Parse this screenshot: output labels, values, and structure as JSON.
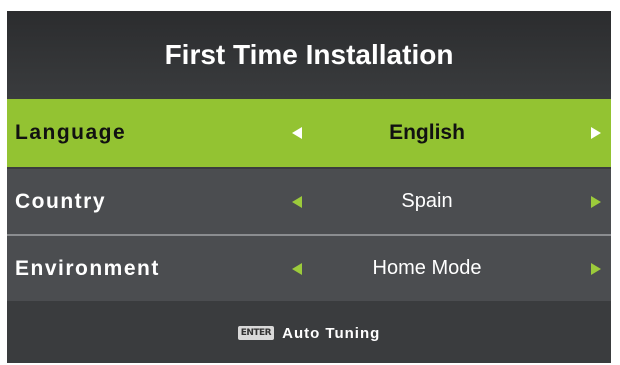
{
  "title": "First Time Installation",
  "rows": [
    {
      "label": "Language",
      "value": "English",
      "selected": true
    },
    {
      "label": "Country",
      "value": "Spain",
      "selected": false
    },
    {
      "label": "Environment",
      "value": "Home Mode",
      "selected": false
    }
  ],
  "footer": {
    "key_label": "ENTER",
    "action": "Auto Tuning"
  },
  "icons": {
    "left": "arrow-left-icon",
    "right": "arrow-right-icon",
    "enter": "enter-key-icon"
  },
  "colors": {
    "panel_bg": "#3a3c3e",
    "row_bg": "#4b4d50",
    "highlight": "#93c332",
    "arrow_inactive": "#9ccb3b",
    "arrow_active": "#ffffff"
  }
}
